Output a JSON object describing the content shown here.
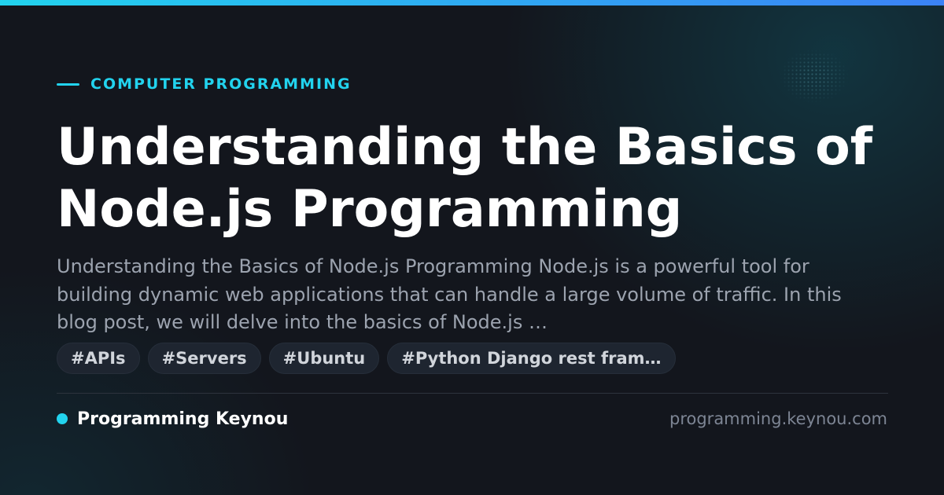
{
  "category": {
    "label": "COMPUTER PROGRAMMING"
  },
  "post": {
    "title": "Understanding the Basics of Node.js Programming",
    "excerpt": "Understanding the Basics of Node.js Programming Node.js is a powerful tool for building dynamic web applications that can handle a large volume of traffic. In this blog post, we will delve into the basics of Node.js …"
  },
  "tags": [
    "#APIs",
    "#Servers",
    "#Ubuntu",
    "#Python Django rest fram…"
  ],
  "footer": {
    "brand_name": "Programming Keynou",
    "domain": "programming.keynou.com"
  },
  "colors": {
    "accent": "#22d3ee",
    "accent_gradient_end": "#3b82f6",
    "background": "#13161d",
    "title": "#ffffff",
    "excerpt": "#9ca3af",
    "tag_background": "#1e2530"
  }
}
